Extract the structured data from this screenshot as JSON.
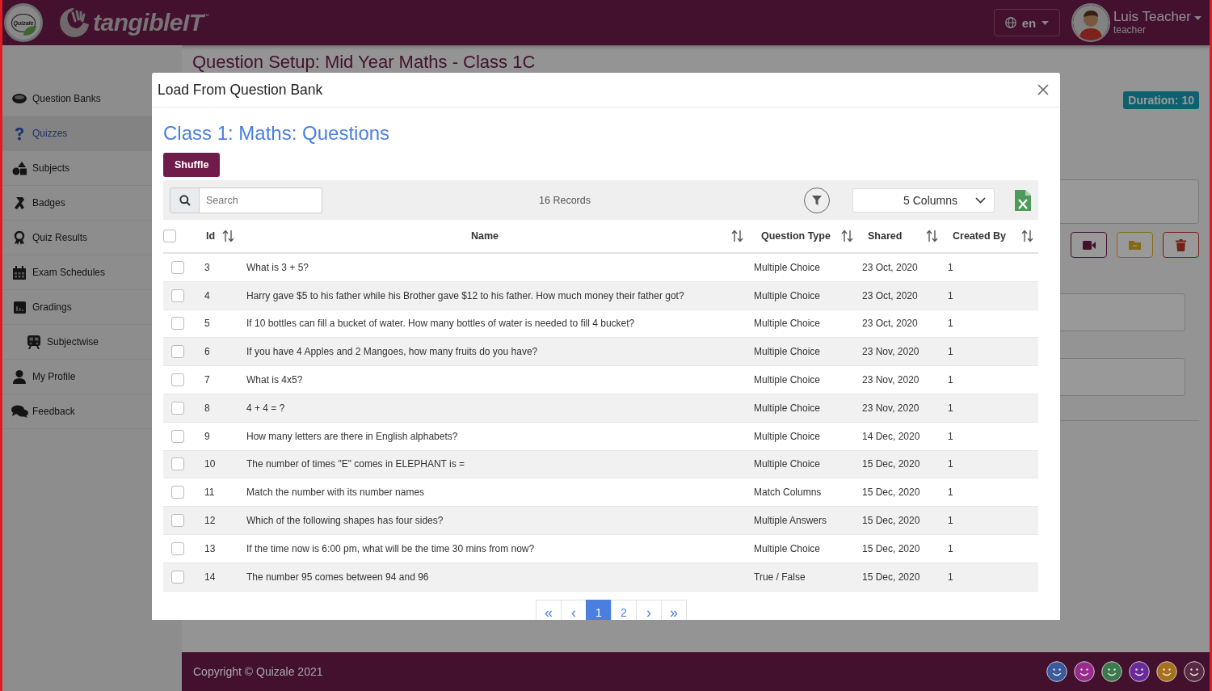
{
  "header": {
    "logo_text": "Quizale",
    "brand": "tangibleIT",
    "brand_mark": "™",
    "language": "en",
    "user": {
      "name": "Luis Teacher",
      "role": "teacher"
    }
  },
  "sidebar": {
    "items": [
      {
        "label": "Question Banks",
        "selected": false
      },
      {
        "label": "Quizzes",
        "selected": true
      },
      {
        "label": "Subjects",
        "selected": false
      },
      {
        "label": "Badges",
        "selected": false
      },
      {
        "label": "Quiz Results",
        "selected": false
      },
      {
        "label": "Exam Schedules",
        "selected": false
      },
      {
        "label": "Gradings",
        "selected": false,
        "children": [
          {
            "label": "Subjectwise",
            "selected": false
          }
        ]
      },
      {
        "label": "My Profile",
        "selected": false
      },
      {
        "label": "Feedback",
        "selected": false
      }
    ]
  },
  "page": {
    "title": "Question Setup: Mid Year Maths - Class 1C",
    "duration": "Duration: 10"
  },
  "modal": {
    "title": "Load From Question Bank",
    "heading": "Class 1: Maths: Questions",
    "shuffle": "Shuffle",
    "search": {
      "placeholder": "Search"
    },
    "records": "16 Records",
    "columns_select": "5 Columns",
    "columns": [
      "Id",
      "Name",
      "Question Type",
      "Shared",
      "Created By"
    ],
    "rows": [
      {
        "id": "3",
        "name": "What is 3 + 5?",
        "type": "Multiple Choice",
        "shared": "23 Oct, 2020",
        "created_by": "1",
        "checked": false
      },
      {
        "id": "4",
        "name": "Harry gave $5 to his father while his Brother gave $12 to his father. How much money their father got?",
        "type": "Multiple Choice",
        "shared": "23 Oct, 2020",
        "created_by": "1",
        "checked": false
      },
      {
        "id": "5",
        "name": "If 10 bottles can fill a bucket of water. How many bottles of water is needed to fill 4 bucket?",
        "type": "Multiple Choice",
        "shared": "23 Oct, 2020",
        "created_by": "1",
        "checked": false
      },
      {
        "id": "6",
        "name": "If you have 4 Apples and 2 Mangoes, how many fruits do you have?",
        "type": "Multiple Choice",
        "shared": "23 Nov, 2020",
        "created_by": "1",
        "checked": false
      },
      {
        "id": "7",
        "name": "What is 4x5?",
        "type": "Multiple Choice",
        "shared": "23 Nov, 2020",
        "created_by": "1",
        "checked": false
      },
      {
        "id": "8",
        "name": "4 + 4 = ?",
        "type": "Multiple Choice",
        "shared": "23 Nov, 2020",
        "created_by": "1",
        "checked": false
      },
      {
        "id": "9",
        "name": "How many letters are there in English alphabets?",
        "type": "Multiple Choice",
        "shared": "14 Dec, 2020",
        "created_by": "1",
        "checked": false
      },
      {
        "id": "10",
        "name": "The number of times \"E\" comes in ELEPHANT is =",
        "type": "Multiple Choice",
        "shared": "15 Dec, 2020",
        "created_by": "1",
        "checked": false
      },
      {
        "id": "11",
        "name": "Match the number with its number names",
        "type": "Match Columns",
        "shared": "15 Dec, 2020",
        "created_by": "1",
        "checked": false
      },
      {
        "id": "12",
        "name": "Which of the following shapes has four sides?",
        "type": "Multiple Answers",
        "shared": "15 Dec, 2020",
        "created_by": "1",
        "checked": false
      },
      {
        "id": "13",
        "name": "If the time now is 6:00 pm, what will be the time 30 mins from now?",
        "type": "Multiple Choice",
        "shared": "15 Dec, 2020",
        "created_by": "1",
        "checked": false
      },
      {
        "id": "14",
        "name": "The number 95 comes between 94 and 96",
        "type": "True / False",
        "shared": "15 Dec, 2020",
        "created_by": "1",
        "checked": false
      }
    ],
    "select_all": {
      "checked": false
    },
    "pagination": [
      {
        "label": "«",
        "kind": "first",
        "selected": false
      },
      {
        "label": "‹",
        "kind": "prev",
        "selected": false
      },
      {
        "label": "1",
        "kind": "page",
        "selected": true
      },
      {
        "label": "2",
        "kind": "page",
        "selected": false
      },
      {
        "label": "›",
        "kind": "next",
        "selected": false
      },
      {
        "label": "»",
        "kind": "last",
        "selected": false
      }
    ]
  },
  "footer": {
    "copyright": "Copyright © Quizale 2021",
    "themes": [
      {
        "color": "#3a5a9e"
      },
      {
        "color": "#9a2a8c"
      },
      {
        "color": "#3a7a4c"
      },
      {
        "color": "#6a2a9c"
      },
      {
        "color": "#a8701c"
      },
      {
        "color": "#5a2a44"
      }
    ]
  }
}
